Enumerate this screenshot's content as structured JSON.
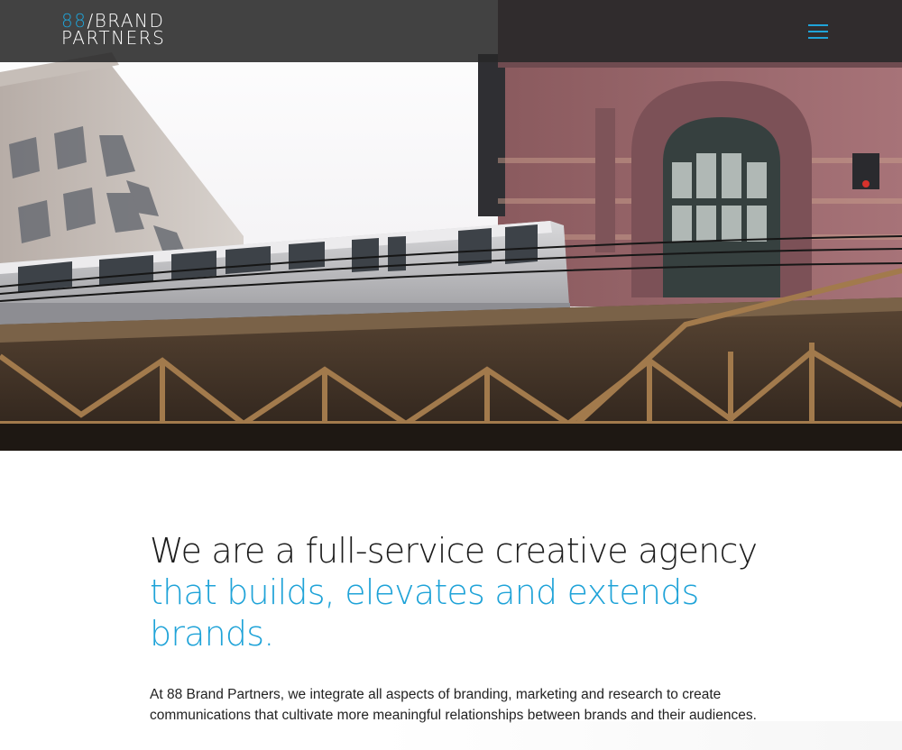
{
  "brand": {
    "logo_number": "88",
    "logo_slash_word": "/BRAND",
    "logo_line2": "PARTNERS"
  },
  "nav": {
    "menu_icon": "hamburger-menu-icon"
  },
  "hero": {
    "image_subject": "elevated-train-photo"
  },
  "main": {
    "headline_line1": "We are a full-service creative agency",
    "headline_line2": "that builds, elevates and extends",
    "headline_line3": "brands.",
    "intro_text": "At 88 Brand Partners, we integrate all aspects of branding, marketing and research to create communications that cultivate more meaningful relationships between brands and their audiences."
  },
  "colors": {
    "accent": "#1fa3d8",
    "navbar": "#2b2b2b",
    "text": "#1c1c1c"
  }
}
